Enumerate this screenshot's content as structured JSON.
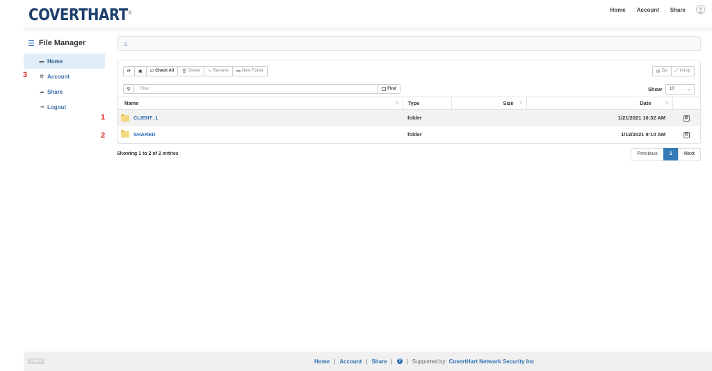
{
  "header": {
    "logo": "COVERTHART",
    "logo_mark": "®",
    "nav": [
      "Home",
      "Account",
      "Share"
    ]
  },
  "sidebar": {
    "title": "File Manager",
    "items": [
      {
        "label": "Home",
        "icon": "folder-icon",
        "active": true
      },
      {
        "label": "Account",
        "icon": "gear-icon",
        "active": false
      },
      {
        "label": "Share",
        "icon": "cloud-icon",
        "active": false
      },
      {
        "label": "Logout",
        "icon": "logout-icon",
        "active": false
      }
    ]
  },
  "annotations": {
    "m1": "1",
    "m2": "2",
    "m3": "3"
  },
  "toolbar": {
    "check_all": "Check All",
    "delete": "Delete",
    "rename": "Rename",
    "new_folder": "New Folder",
    "zip": "Zip",
    "unzip": "Unzip"
  },
  "filter": {
    "placeholder": "Filter",
    "find": "Find",
    "show_label": "Show",
    "show_value": "10"
  },
  "table": {
    "headers": [
      "Name",
      "Type",
      "Size",
      "Date"
    ],
    "rows": [
      {
        "name": "CLIENT_1",
        "type": "folder",
        "size": "",
        "date": "1/21/2021 10:32 AM"
      },
      {
        "name": "SHARED",
        "type": "folder",
        "size": "",
        "date": "1/12/2021 9:10 AM"
      }
    ]
  },
  "pagination": {
    "info": "Showing 1 to 2 of 2 entries",
    "previous": "Previous",
    "current": "1",
    "next": "Next"
  },
  "footer": {
    "language": "English",
    "home": "Home",
    "account": "Account",
    "share": "Share",
    "supported_prefix": "Supported by:",
    "supported_by": "CovertHart Network Security Inc"
  },
  "colors": {
    "brand": "#1d3f6e",
    "link": "#2f6fb3",
    "annotation": "#e02020",
    "active_page": "#337ab7"
  }
}
